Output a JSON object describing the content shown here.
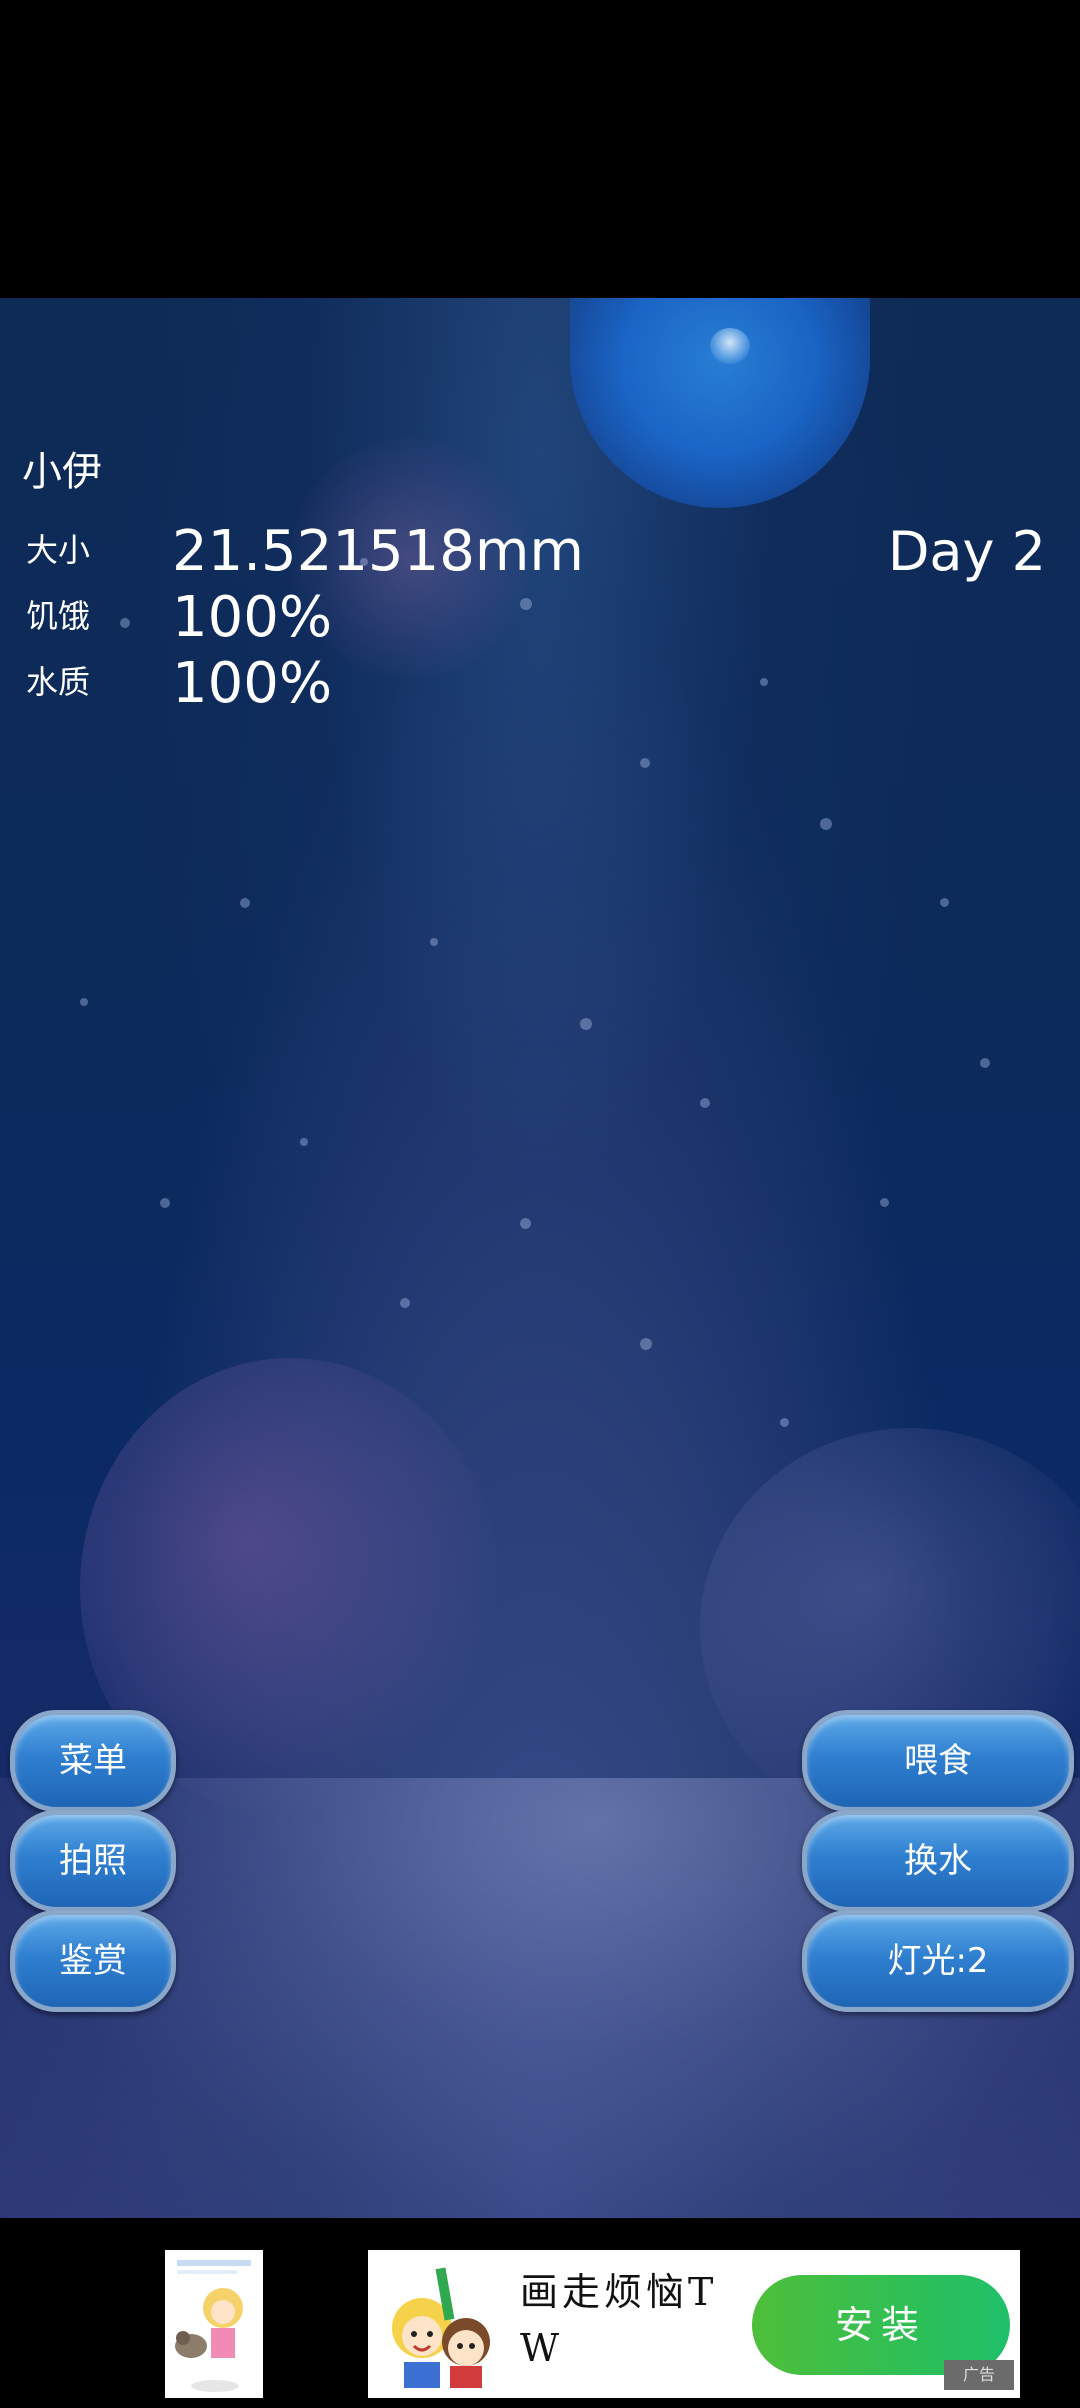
{
  "pet": {
    "name": "小伊",
    "day": "Day 2",
    "stats": [
      {
        "label": "大小",
        "value": "21.521518mm"
      },
      {
        "label": "饥饿",
        "value": "100%"
      },
      {
        "label": "水质",
        "value": "100%"
      }
    ]
  },
  "buttons": {
    "left": [
      "菜单",
      "拍照",
      "鉴赏"
    ],
    "right": [
      "喂食",
      "换水",
      "灯光:2"
    ]
  },
  "ad": {
    "title": "画走烦恼TW",
    "install_label": "安装",
    "tag": "广告"
  },
  "colors": {
    "button_gradient_top": "#5da9e8",
    "button_gradient_bottom": "#1f65b6",
    "install_green": "#2fbf55"
  },
  "icons": [
    "jellyfish-icon",
    "ad-thumbnail-image",
    "ad-cartoon-icon"
  ]
}
